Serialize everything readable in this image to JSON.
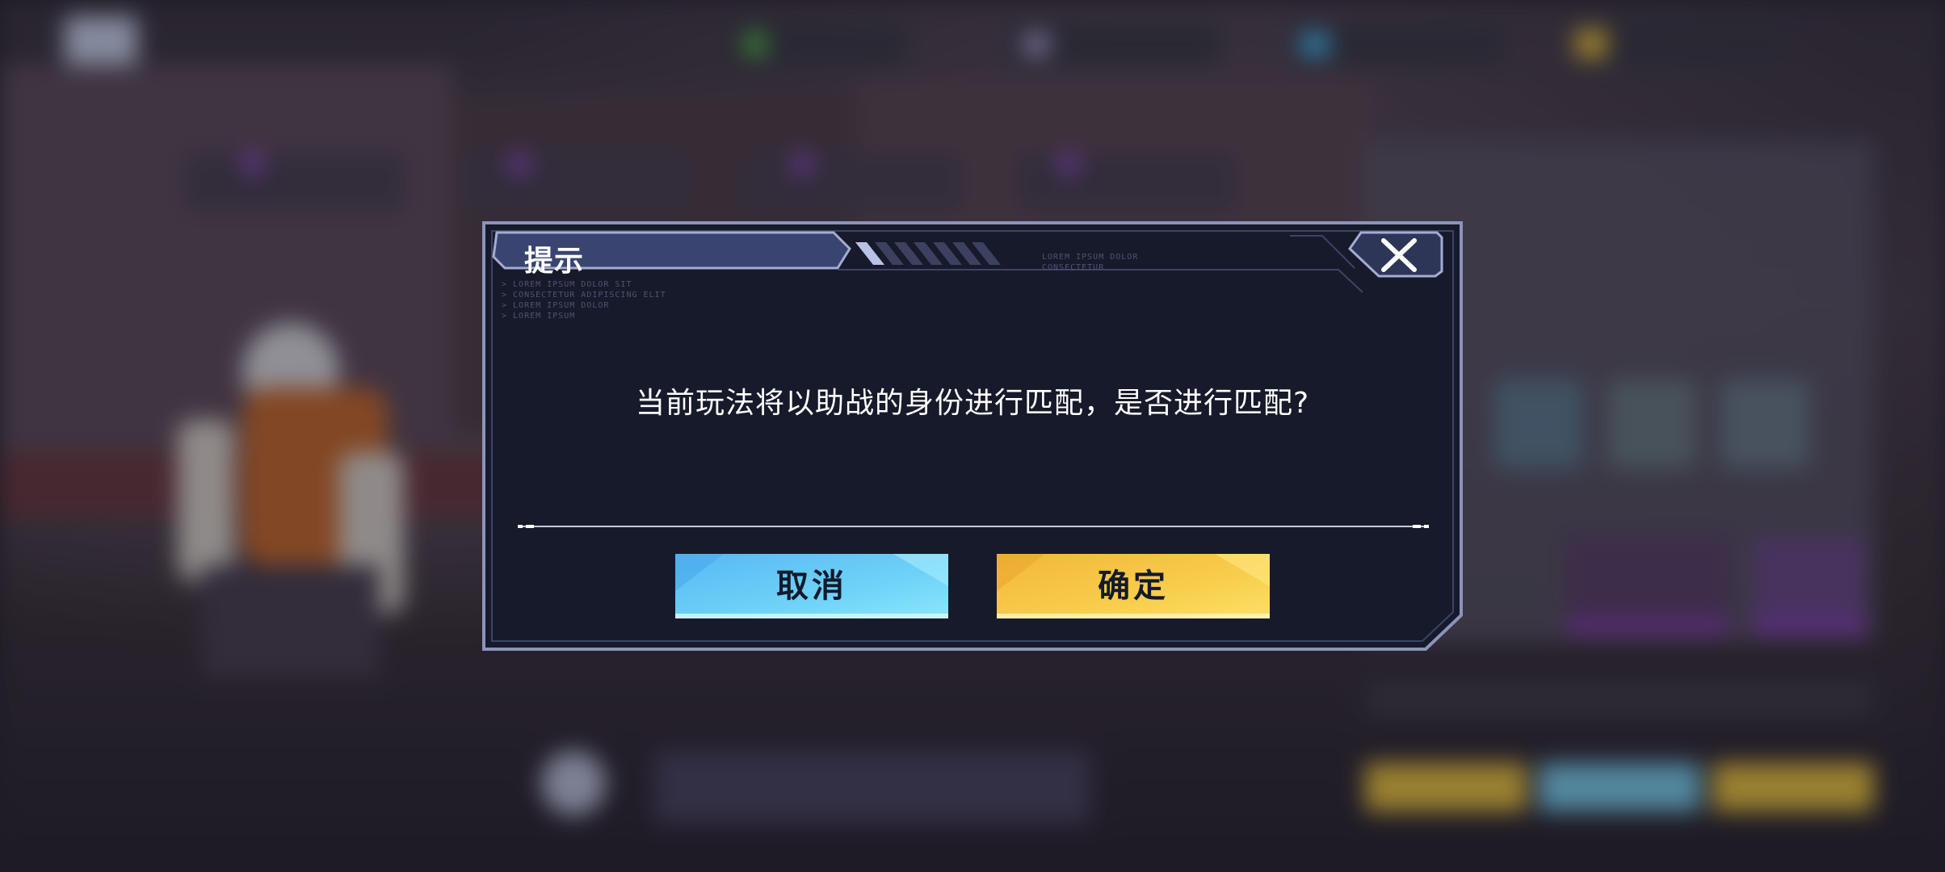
{
  "dialog": {
    "title": "提示",
    "message": "当前玩法将以助战的身份进行匹配，是否进行匹配?",
    "cancel_label": "取消",
    "confirm_label": "确定",
    "close_icon": "close-icon",
    "deco_header": "LOREM IPSUM DOLOR\nCONSECTETUR",
    "deco_left": "> LOREM IPSUM DOLOR SIT\n> CONSECTETUR ADIPISCING ELIT\n> LOREM IPSUM DOLOR\n> LOREM IPSUM"
  },
  "colors": {
    "dialog_bg": "#171a2a",
    "dialog_border": "#8a93b8",
    "title_bar": "#3c4672",
    "cancel_btn": "#62c8f6",
    "confirm_btn": "#f6c94a",
    "text": "#ffffff"
  }
}
